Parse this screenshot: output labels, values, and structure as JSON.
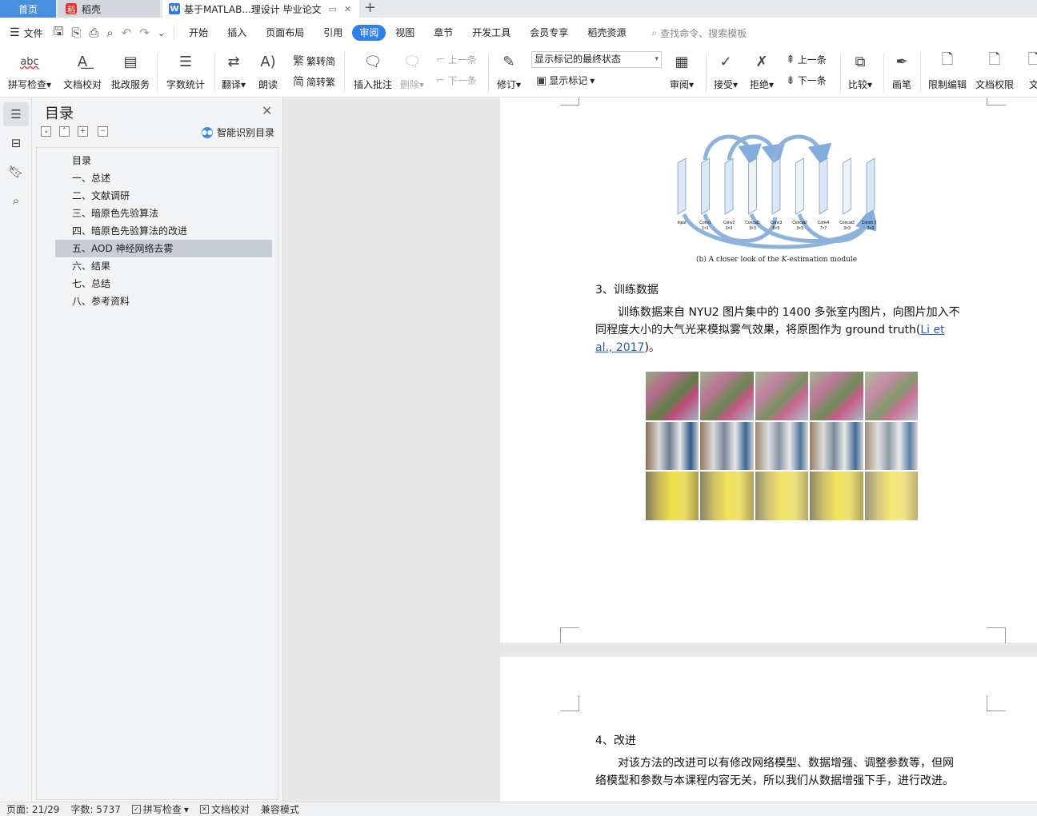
{
  "tabs": {
    "home": "首页",
    "daoke": "稻壳",
    "doc_title": "基于MATLAB...理设计 毕业论文"
  },
  "menu": {
    "file": "文件",
    "items": [
      "开始",
      "插入",
      "页面布局",
      "引用",
      "审阅",
      "视图",
      "章节",
      "开发工具",
      "会员专享",
      "稻壳资源"
    ],
    "active": "审阅",
    "search_placeholder": "查找命令、搜索模板"
  },
  "ribbon": {
    "spell": "拼写检查",
    "proof": "文档校对",
    "revise_service": "批改服务",
    "word_count": "字数统计",
    "translate": "翻译",
    "read_aloud": "朗读",
    "trad_to_simp": "繁转简",
    "simp_to_trad": "简转繁",
    "insert_comment": "插入批注",
    "delete": "删除",
    "prev_item": "上一条",
    "next_item": "下一条",
    "track_changes": "修订",
    "markup_state": "显示标记的最终状态",
    "show_markup": "显示标记",
    "review": "审阅",
    "accept": "接受",
    "reject": "拒绝",
    "prev_change": "上一条",
    "next_change": "下一条",
    "compare": "比较",
    "ink": "画笔",
    "restrict_edit": "限制编辑",
    "doc_rights": "文档权限",
    "doc_cut": "文"
  },
  "nav": {
    "title": "目录",
    "smart_toc": "智能识别目录",
    "toc": [
      "目录",
      "一、总述",
      "二、文献调研",
      "三、暗原色先验算法",
      "四、暗原色先验算法的改进",
      "五、AOD 神经网络去雾",
      "六、结果",
      "七、总结",
      "八、参考资料"
    ],
    "selected_index": 5
  },
  "doc": {
    "figure_caption_a": "(b) A closer look of the ",
    "figure_caption_k": "K",
    "figure_caption_b": "-estimation module",
    "arch_labels": [
      "Input",
      "Conv1",
      "Conv2",
      "Concat1",
      "Conv3",
      "Concat2",
      "Conv4",
      "Concat3",
      "Conv5 (K)"
    ],
    "arch_sublabels": [
      "",
      "1×1",
      "3×3",
      "3×3",
      "5×5",
      "3×3",
      "7×7",
      "3×3",
      "3×3"
    ],
    "section3_heading": "3、训练数据",
    "section3_para": "训练数据来自 NYU2 图片集中的 1400 多张室内图片，向图片加入不同程度大小的大气光来模拟雾气效果，将原图作为 ground truth(",
    "section3_cite": "Li et al., 2017",
    "section3_tail": ")。",
    "section4_heading": "4、改进",
    "section4_para": "对该方法的改进可以有修改网络模型、数据增强、调整参数等，但网络模型和参数与本课程内容无关，所以我们从数据增强下手，进行改进。"
  },
  "status": {
    "page": "页面: 21/29",
    "words": "字数: 5737",
    "spell": "拼写检查",
    "proof": "文档校对",
    "compat": "兼容模式"
  },
  "colors": {
    "accent": "#2f80e8",
    "home_tab": "#4a8fde",
    "toc_selected": "#c9ced6",
    "cite_link": "#2a56c6"
  }
}
